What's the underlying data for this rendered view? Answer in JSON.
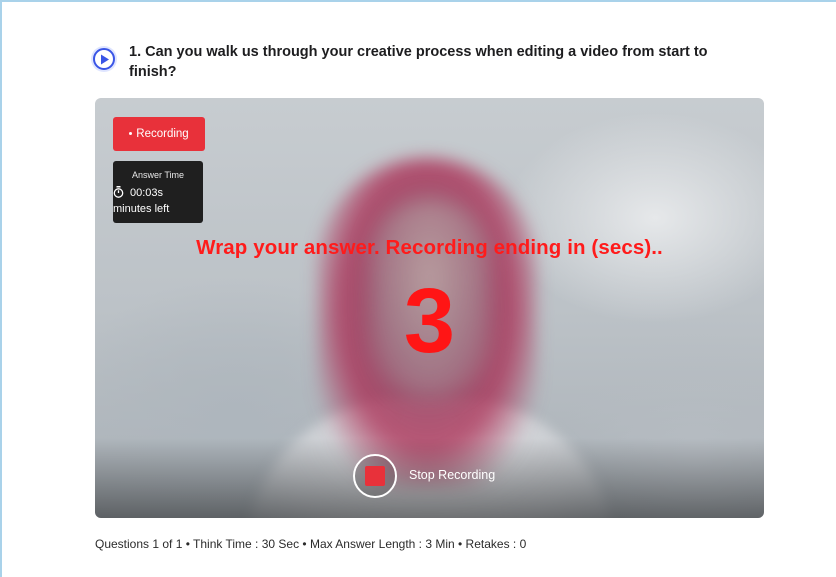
{
  "question": {
    "text": "1. Can you walk us through your creative process when editing a video from start to finish?"
  },
  "recording": {
    "badge_label": "Recording",
    "answer_time_title": "Answer Time",
    "answer_time_value": "00:03s",
    "answer_time_suffix": "minutes left",
    "wrap_message": "Wrap your answer. Recording ending in (secs)..",
    "countdown": "3",
    "stop_label": "Stop Recording"
  },
  "meta": {
    "summary": "Questions 1 of 1 • Think Time : 30 Sec • Max Answer Length : 3 Min • Retakes : 0"
  },
  "colors": {
    "accent": "#3a55e6",
    "recording_red": "#e8313a",
    "countdown_red": "#ff1515",
    "frame_border": "#a9d2ea"
  },
  "icons": [
    "play-icon",
    "record-dot-icon",
    "stopwatch-icon",
    "stop-icon"
  ]
}
